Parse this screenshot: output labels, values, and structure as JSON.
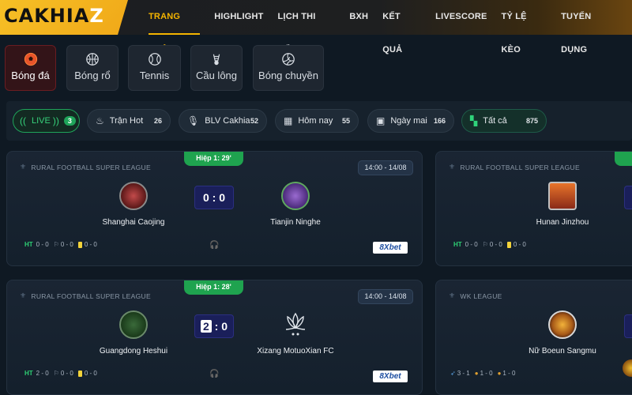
{
  "header": {
    "logo_main": "CAKHIA",
    "logo_z": "Z",
    "nav": [
      "TRANG CHỦ",
      "HIGHLIGHT",
      "LỊCH THI ĐẤU",
      "BXH",
      "KẾT QUẢ",
      "LIVESCORE",
      "TỶ LỆ KÈO",
      "TUYỂN DỤNG"
    ]
  },
  "sports": [
    "Bóng đá",
    "Bóng rổ",
    "Tennis",
    "Cầu lông",
    "Bóng chuyền"
  ],
  "filters": {
    "live": {
      "label": "LIVE",
      "count": "3"
    },
    "hot": {
      "label": "Trận Hot",
      "count": "26"
    },
    "blv": {
      "label": "BLV Cakhia",
      "count": "52"
    },
    "today": {
      "label": "Hôm nay",
      "count": "55"
    },
    "tomorrow": {
      "label": "Ngày mai",
      "count": "166"
    },
    "all": {
      "label": "Tất cả",
      "count": "875"
    }
  },
  "matches": [
    {
      "league": "RURAL FOOTBALL SUPER LEAGUE",
      "status": "Hiệp 1: 29'",
      "time": "14:00 - 14/08",
      "home": "Shanghai Caojing",
      "away": "Tianjin Ninghe",
      "score_home": "0",
      "score_sep": ":",
      "score_away": "0",
      "ht_label": "HT",
      "ht": "0 - 0",
      "corners": "0 - 0",
      "cards": "0 - 0",
      "bookie": "8Xbet"
    },
    {
      "league": "RURAL FOOTBALL SUPER LEAGUE",
      "status": "Hiệp 1: 28'",
      "time": "14:00 - 14/08",
      "home": "Guangdong Heshui",
      "away": "Xizang MotuoXian FC",
      "score_home": "2",
      "score_sep": ":",
      "score_away": "0",
      "ht_label": "HT",
      "ht": "2 - 0",
      "corners": "0 - 0",
      "cards": "0 - 0",
      "bookie": "8Xbet"
    },
    {
      "league": "RURAL FOOTBALL SUPER LEAGUE",
      "home": "Hunan Jinzhou",
      "ht_label": "HT",
      "ht": "0 - 0",
      "corners": "0 - 0",
      "cards": "0 - 0"
    },
    {
      "league": "WK LEAGUE",
      "home": "Nữ Boeun Sangmu",
      "s1": "3 - 1",
      "s2": "1 - 0",
      "s3": "1 - 0"
    }
  ],
  "colors": {
    "accent": "#f4b400",
    "live_green": "#1fa45a",
    "score_bg": "#1a1f5a",
    "active_sport": "#331418"
  }
}
